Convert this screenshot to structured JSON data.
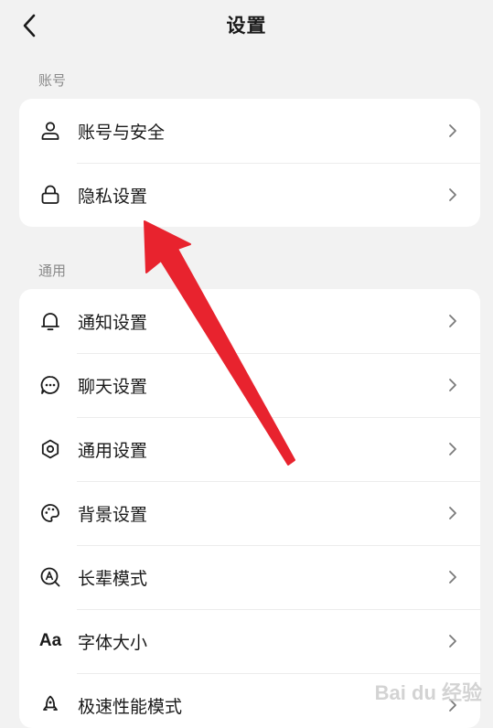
{
  "header": {
    "title": "设置"
  },
  "sections": {
    "account": {
      "label": "账号",
      "items": [
        {
          "label": "账号与安全",
          "icon": "user-icon"
        },
        {
          "label": "隐私设置",
          "icon": "lock-icon"
        }
      ]
    },
    "general": {
      "label": "通用",
      "items": [
        {
          "label": "通知设置",
          "icon": "bell-icon"
        },
        {
          "label": "聊天设置",
          "icon": "chat-bubble-icon"
        },
        {
          "label": "通用设置",
          "icon": "gear-icon"
        },
        {
          "label": "背景设置",
          "icon": "palette-icon"
        },
        {
          "label": "长辈模式",
          "icon": "elder-mode-icon"
        },
        {
          "label": "字体大小",
          "icon": "font-size-icon",
          "glyph": "Aa"
        },
        {
          "label": "极速性能模式",
          "icon": "rocket-icon"
        }
      ]
    }
  },
  "annotation": {
    "color": "#e8232e",
    "icon": "red-arrow-annotation"
  },
  "watermark": {
    "text": "Bai du 经验"
  }
}
